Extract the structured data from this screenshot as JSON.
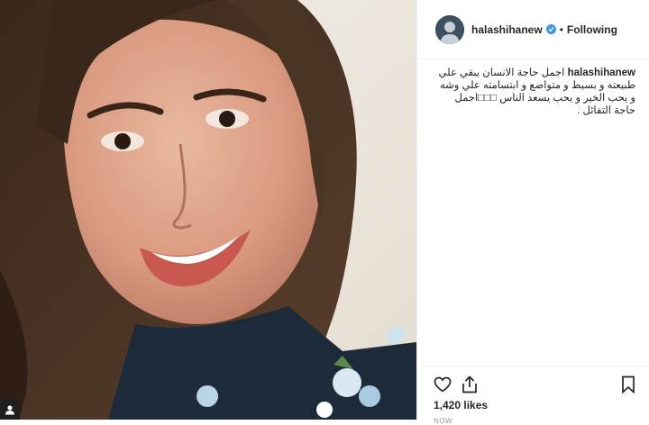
{
  "post": {
    "username": "halashihanew",
    "follow_state": "Following",
    "separator": "•",
    "caption_user": "halashihanew",
    "caption_text": "اجمل حاجة الانسان يبقي علي طبيعته و بسيط و متواضع و ابتسامته علي وشه و يحب الخير و يحب يسعد الناس □□□اجمل حاجة التفائل .",
    "likes": "1,420 likes",
    "date": "NOW"
  },
  "colors": {
    "verified": "#3897f0",
    "text": "#262626",
    "border": "#efefef"
  },
  "icons": {
    "like": "heart-outline-icon",
    "share": "share-upload-icon",
    "save": "bookmark-icon",
    "verified": "verified-badge-icon",
    "user_tag": "user-tag-icon"
  }
}
